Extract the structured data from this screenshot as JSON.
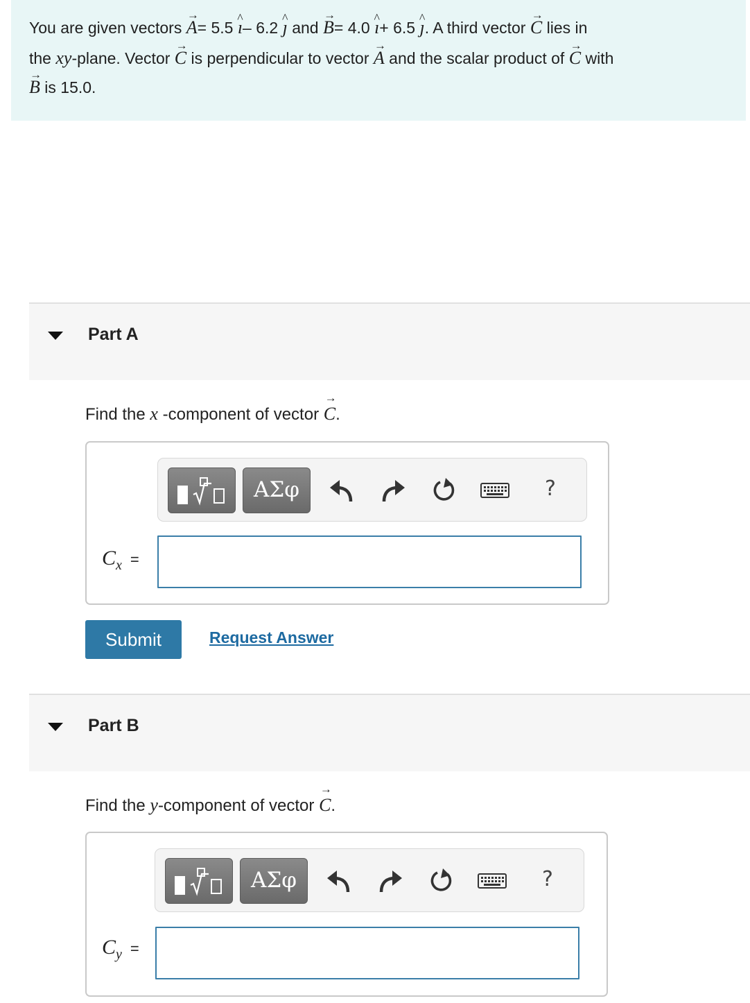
{
  "problem": {
    "p1": "You are given vectors",
    "vecA": "A",
    "eqA": "= 5.5",
    "i1": "ı",
    "minus": "– 6.2",
    "j1": "ȷ",
    "and": "and",
    "vecB": "B",
    "eqB": "= 4.0",
    "i2": "ı",
    "plus": "+ 6.5",
    "j2": "ȷ",
    "p2": ". A third vector",
    "vecC1": "C",
    "p3": "lies in",
    "p4": "the",
    "xy": "xy",
    "p5": "-plane. Vector",
    "vecC2": "C",
    "p6": "is perpendicular to vector",
    "vecA2": "A",
    "p7": "and the scalar product of",
    "vecC3": "C",
    "p8": "with",
    "vecB2": "B",
    "p9": "is 15.0."
  },
  "partA": {
    "title": "Part A",
    "q_before": "Find the",
    "q_var": "x",
    "q_mid": "-component of vector",
    "q_vec": "C",
    "q_end": ".",
    "label_main": "C",
    "label_sub": "x",
    "label_eq": "=",
    "input_value": "",
    "submit_label": "Submit",
    "request_label": "Request Answer"
  },
  "partB": {
    "title": "Part B",
    "q_before": "Find the",
    "q_var": "y",
    "q_mid": "-component of vector",
    "q_vec": "C",
    "q_end": ".",
    "label_main": "C",
    "label_sub": "y",
    "label_eq": "=",
    "input_value": ""
  },
  "toolbar": {
    "greek_label": "ΑΣφ",
    "help_label": "?",
    "icons": [
      "templates-icon",
      "greek-symbols-icon",
      "undo-icon",
      "redo-icon",
      "reset-icon",
      "keyboard-icon",
      "help-icon"
    ]
  }
}
